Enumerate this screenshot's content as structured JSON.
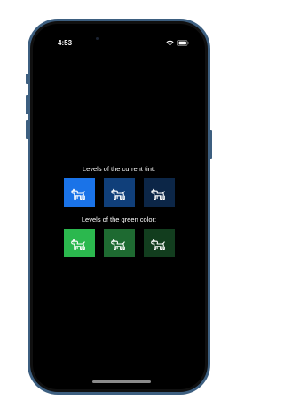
{
  "status_bar": {
    "time": "4:53"
  },
  "sections": [
    {
      "label": "Levels of the current tint:",
      "tiles": [
        {
          "color": "#1a73e8",
          "icon": "dog-icon"
        },
        {
          "color": "#103f7a",
          "icon": "dog-icon"
        },
        {
          "color": "#0c2647",
          "icon": "dog-icon"
        }
      ]
    },
    {
      "label": "Levels of the green color:",
      "tiles": [
        {
          "color": "#2bb84e",
          "icon": "dog-icon"
        },
        {
          "color": "#1e6a31",
          "icon": "dog-icon"
        },
        {
          "color": "#123d1e",
          "icon": "dog-icon"
        }
      ]
    }
  ]
}
